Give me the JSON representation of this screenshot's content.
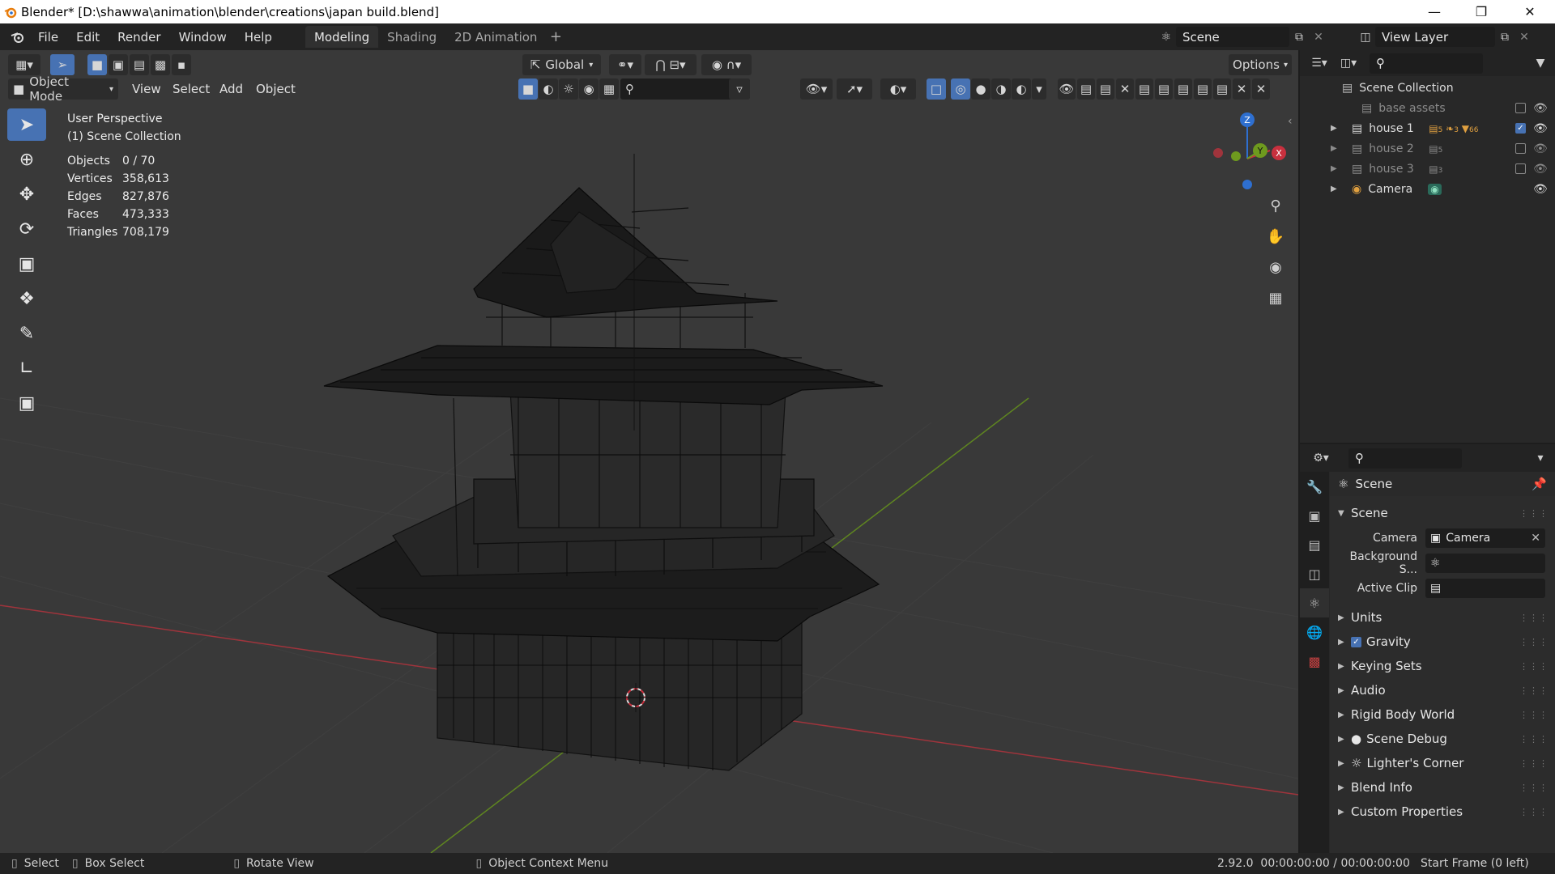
{
  "window": {
    "title": "Blender* [D:\\shawwa\\animation\\blender\\creations\\japan build.blend]"
  },
  "topbar": {
    "menus": [
      "File",
      "Edit",
      "Render",
      "Window",
      "Help"
    ],
    "workspaces": [
      "Modeling",
      "Shading",
      "2D Animation"
    ],
    "active_workspace": "Modeling",
    "scene_label": "Scene",
    "view_layer_label": "View Layer"
  },
  "viewport": {
    "transform_orientation": "Global",
    "options_label": "Options",
    "mode": "Object Mode",
    "menus": [
      "View",
      "Select",
      "Add",
      "Object"
    ],
    "perspective": "User Perspective",
    "collection_label": "(1) Scene Collection",
    "stats": [
      {
        "label": "Objects",
        "value": "0 / 70"
      },
      {
        "label": "Vertices",
        "value": "358,613"
      },
      {
        "label": "Edges",
        "value": "827,876"
      },
      {
        "label": "Faces",
        "value": "473,333"
      },
      {
        "label": "Triangles",
        "value": "708,179"
      }
    ],
    "gizmo_axes": {
      "z": "Z",
      "y": "Y",
      "x": "X"
    }
  },
  "outliner": {
    "root": "Scene Collection",
    "items": [
      {
        "name": "base assets",
        "dim": true,
        "checked": false,
        "badge": ""
      },
      {
        "name": "house 1",
        "dim": false,
        "checked": true,
        "badge": "5 3 66"
      },
      {
        "name": "house 2",
        "dim": true,
        "checked": false,
        "badge": "5"
      },
      {
        "name": "house 3",
        "dim": true,
        "checked": false,
        "badge": "3"
      },
      {
        "name": "Camera",
        "dim": false,
        "checked": null,
        "badge": ""
      }
    ]
  },
  "properties": {
    "context": "Scene",
    "panel_title": "Scene",
    "fields": [
      {
        "label": "Camera",
        "value": "Camera"
      },
      {
        "label": "Background S...",
        "value": ""
      },
      {
        "label": "Active Clip",
        "value": ""
      }
    ],
    "panels": [
      "Units",
      "Gravity",
      "Keying Sets",
      "Audio",
      "Rigid Body World",
      "Scene Debug",
      "Lighter's Corner",
      "Blend Info",
      "Custom Properties"
    ]
  },
  "statusbar": {
    "select": "Select",
    "box_select": "Box Select",
    "rotate_view": "Rotate View",
    "context_menu": "Object Context Menu",
    "version_time": "2.92.0  00:00:00:00 / 00:00:00:00",
    "start_frame": "Start Frame (0 left)"
  },
  "colors": {
    "accent": "#4772b3",
    "x_axis": "#c8303e",
    "y_axis": "#6e9a1e",
    "z_axis": "#2e6fd0"
  }
}
